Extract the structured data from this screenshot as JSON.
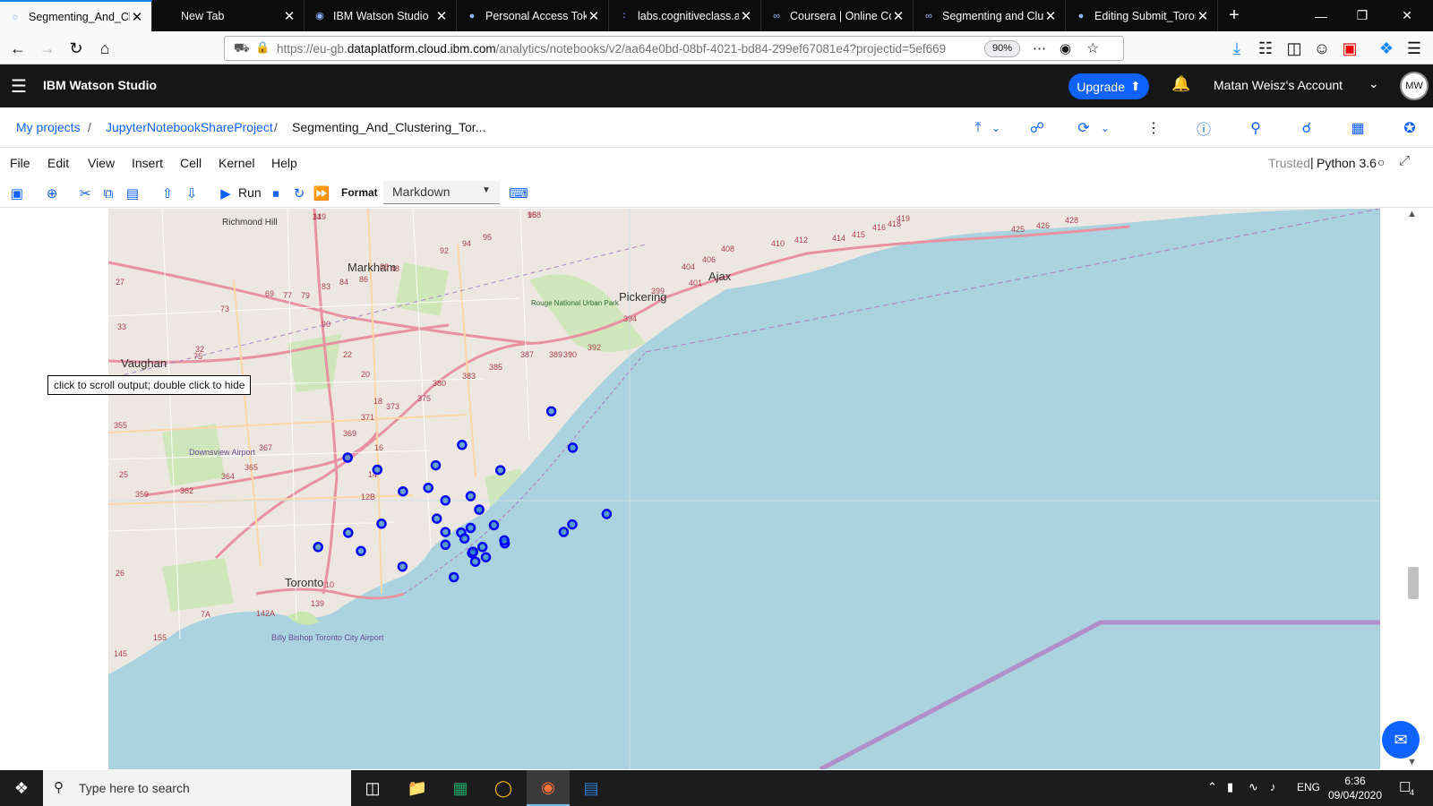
{
  "browser": {
    "tabs": [
      {
        "title": "Segmenting_And_Clu",
        "active": true,
        "icon": "jupyter-icon"
      },
      {
        "title": "New Tab",
        "active": false,
        "icon": ""
      },
      {
        "title": "IBM Watson Studio",
        "active": false,
        "icon": "ibm-icon"
      },
      {
        "title": "Personal Access Toke",
        "active": false,
        "icon": "github-icon"
      },
      {
        "title": "labs.cognitiveclass.a",
        "active": false,
        "icon": "labs-icon"
      },
      {
        "title": "Coursera | Online Co",
        "active": false,
        "icon": "coursera-icon"
      },
      {
        "title": "Segmenting and Clu",
        "active": false,
        "icon": "coursera-icon"
      },
      {
        "title": "Editing Submit_Toron",
        "active": false,
        "icon": "github-icon"
      }
    ],
    "url_prefix": "https://eu-gb.",
    "url_domain": "dataplatform.cloud.ibm.com",
    "url_rest": "/analytics/notebooks/v2/aa64e0bd-08bf-4021-bd84-299ef67081e4?projectid=5ef669",
    "zoom": "90%"
  },
  "app": {
    "brand": "IBM Watson Studio",
    "upgrade_label": "Upgrade",
    "account": "Matan Weisz's Account",
    "avatar": "MW"
  },
  "breadcrumb": {
    "items": [
      "My projects",
      "JupyterNotebookShareProject",
      "Segmenting_And_Clustering_Tor..."
    ]
  },
  "jupyter": {
    "menus": [
      "File",
      "Edit",
      "View",
      "Insert",
      "Cell",
      "Kernel",
      "Help"
    ],
    "trusted": "Trusted",
    "kernel": "Python 3.6",
    "run_label": "Run",
    "format_label": "Format",
    "format_value": "Markdown",
    "tooltip": "click to scroll output; double click to hide"
  },
  "map": {
    "place_labels": [
      "Richmond Hill",
      "Markham",
      "Pickering",
      "Ajax",
      "Vaughan",
      "Downsview Airport",
      "Toronto",
      "Billy Bishop Toronto City Airport",
      "Rouge National Urban Park"
    ],
    "route_labels": [
      "31",
      "98",
      "92",
      "94",
      "95",
      "48",
      "404",
      "406",
      "408",
      "410",
      "412",
      "414",
      "415",
      "416",
      "418",
      "419",
      "425",
      "426",
      "428",
      "401",
      "399",
      "394",
      "392",
      "390",
      "389",
      "387",
      "385",
      "383",
      "380",
      "375",
      "373",
      "371",
      "369",
      "367",
      "365",
      "364",
      "362",
      "359",
      "355",
      "25",
      "26",
      "27",
      "33",
      "32",
      "73",
      "75",
      "69",
      "77",
      "79",
      "83",
      "84",
      "86",
      "88",
      "90",
      "22",
      "20",
      "18",
      "16",
      "14",
      "12B",
      "10",
      "7A",
      "155",
      "145",
      "142A",
      "139",
      "149",
      "158"
    ],
    "marker_color": "#0000ff",
    "markers": [
      {
        "lat": 43.7532,
        "lng": -79.3297
      },
      {
        "lat": 43.7259,
        "lng": -79.3155
      },
      {
        "lat": 43.6543,
        "lng": -79.3606
      },
      {
        "lat": 43.7185,
        "lng": -79.4648
      },
      {
        "lat": 43.6623,
        "lng": -79.3895
      },
      {
        "lat": 43.6679,
        "lng": -79.3678
      },
      {
        "lat": 43.648,
        "lng": -79.3818
      },
      {
        "lat": 43.6658,
        "lng": -79.3832
      },
      {
        "lat": 43.709,
        "lng": -79.3635
      },
      {
        "lat": 43.6579,
        "lng": -79.3873
      },
      {
        "lat": 43.7094,
        "lng": -79.4451
      },
      {
        "lat": 43.6515,
        "lng": -79.3754
      },
      {
        "lat": 43.6932,
        "lng": -79.4281
      },
      {
        "lat": 43.6439,
        "lng": -79.3731
      },
      {
        "lat": 43.6896,
        "lng": -79.3832
      },
      {
        "lat": 43.6405,
        "lng": -79.3802
      },
      {
        "lat": 43.6477,
        "lng": -79.3817
      },
      {
        "lat": 43.6796,
        "lng": -79.3775
      },
      {
        "lat": 43.6469,
        "lng": -79.3823
      },
      {
        "lat": 43.6684,
        "lng": -79.3158
      },
      {
        "lat": 43.6479,
        "lng": -79.3816
      },
      {
        "lat": 43.6728,
        "lng": -79.4057
      },
      {
        "lat": 43.6627,
        "lng": -79.4
      },
      {
        "lat": 43.6532,
        "lng": -79.4
      },
      {
        "lat": 43.6763,
        "lng": -79.293
      },
      {
        "lat": 43.6628,
        "lng": -79.3215
      },
      {
        "lat": 43.6368,
        "lng": -79.4284
      },
      {
        "lat": 43.669,
        "lng": -79.4423
      },
      {
        "lat": 43.6485,
        "lng": -79.456
      },
      {
        "lat": 43.6515,
        "lng": -79.4844
      },
      {
        "lat": 43.6622,
        "lng": -79.4644
      },
      {
        "lat": 43.6289,
        "lng": -79.3944
      },
      {
        "lat": 43.6795,
        "lng": -79.3775
      },
      {
        "lat": 43.728,
        "lng": -79.3889
      },
      {
        "lat": 43.7127,
        "lng": -79.4064
      },
      {
        "lat": 43.6864,
        "lng": -79.4
      },
      {
        "lat": 43.6959,
        "lng": -79.4113
      },
      {
        "lat": 43.6565,
        "lng": -79.3609
      }
    ]
  },
  "taskbar": {
    "search_placeholder": "Type here to search",
    "language": "ENG",
    "time": "6:36",
    "date": "09/04/2020",
    "notifications": "4"
  }
}
